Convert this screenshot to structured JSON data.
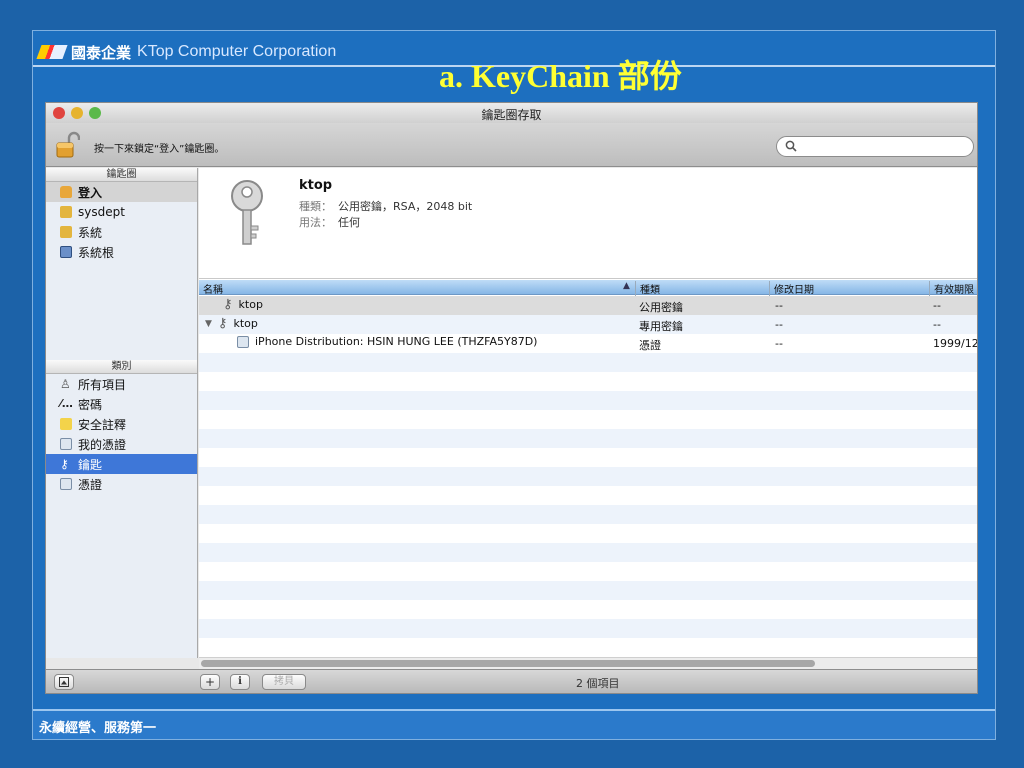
{
  "slide": {
    "brand_cn": "國泰企業",
    "brand_en": "KTop Computer Corporation",
    "title": "a. KeyChain 部份",
    "footer": "永續經營、服務第一"
  },
  "window": {
    "title": "鑰匙圈存取",
    "lock_hint": "按一下來鎖定“登入”鑰匙圈。",
    "search_placeholder": ""
  },
  "sidebar": {
    "keychains_header": "鑰匙圈",
    "keychains": [
      {
        "label": "登入",
        "icon": "open-lock-icon"
      },
      {
        "label": "sysdept",
        "icon": "lock-icon"
      },
      {
        "label": "系統",
        "icon": "lock-icon"
      },
      {
        "label": "系統根",
        "icon": "folder-icon"
      }
    ],
    "category_header": "類別",
    "categories": [
      {
        "label": "所有項目",
        "icon": "all-items-icon"
      },
      {
        "label": "密碼",
        "icon": "password-icon"
      },
      {
        "label": "安全註釋",
        "icon": "note-icon"
      },
      {
        "label": "我的憑證",
        "icon": "my-cert-icon"
      },
      {
        "label": "鑰匙",
        "icon": "key-icon"
      },
      {
        "label": "憑證",
        "icon": "cert-icon"
      }
    ]
  },
  "detail": {
    "name": "ktop",
    "kind_label": "種類：",
    "kind_value": "公用密鑰，RSA，2048 bit",
    "use_label": "用法：",
    "use_value": "任何"
  },
  "table": {
    "headers": [
      "名稱",
      "種類",
      "修改日期",
      "有效期限"
    ],
    "sort_indicator": "▲",
    "rows": [
      {
        "name": "ktop",
        "kind": "公用密鑰",
        "modified": "--",
        "expires": "--",
        "icon": "key-icon"
      },
      {
        "name": "ktop",
        "kind": "專用密鑰",
        "modified": "--",
        "expires": "--",
        "icon": "key-icon",
        "disclosure": "▼"
      },
      {
        "name": "iPhone Distribution: HSIN HUNG LEE (THZFA5Y87D)",
        "kind": "憑證",
        "modified": "--",
        "expires": "1999/12",
        "icon": "cert-icon"
      }
    ]
  },
  "bottom": {
    "add": "+",
    "info": "i",
    "copy": "拷貝",
    "count": "2 個項目"
  },
  "colors": {
    "slide_bg": "#1d6fbf",
    "title_yellow": "#ffff33",
    "selection": "#3e77d8"
  }
}
